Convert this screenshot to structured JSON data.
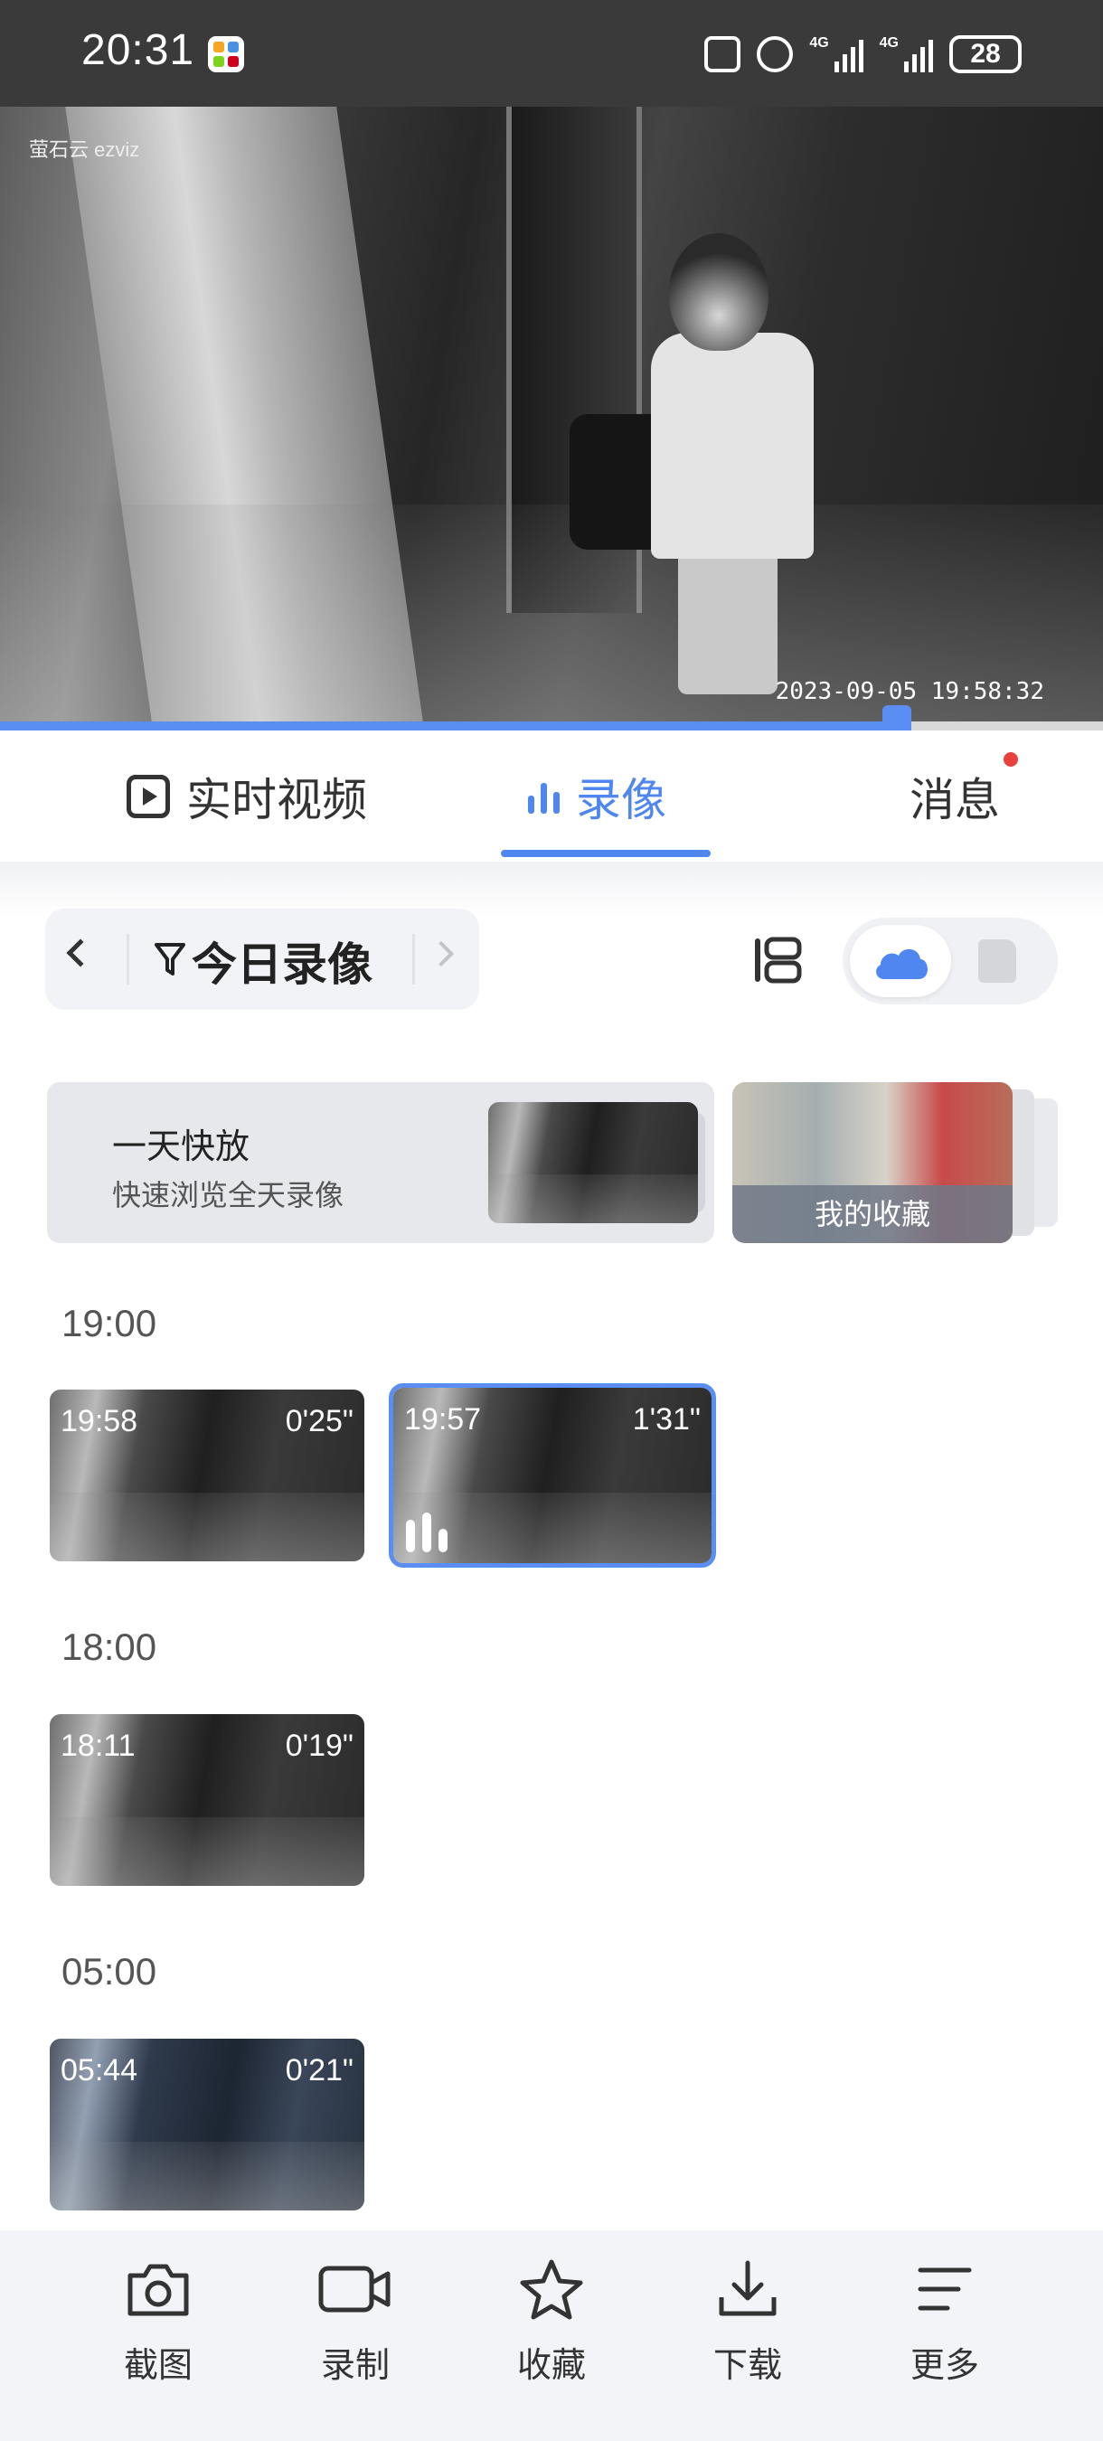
{
  "status_bar": {
    "time": "20:31",
    "network_1": "4G",
    "network_2": "4G",
    "battery": "28"
  },
  "video": {
    "brand_logo": "萤石云 ezviz",
    "timestamp": "2023-09-05 19:58:32",
    "progress": 0.81
  },
  "tabs": [
    {
      "label": "实时视频",
      "icon": "play-square-icon"
    },
    {
      "label": "录像",
      "icon": "bar-chart-icon",
      "active": true
    },
    {
      "label": "消息",
      "icon": "",
      "badge": "red-dot"
    }
  ],
  "filter": {
    "label": "今日录像"
  },
  "storage": {
    "selected": "cloud",
    "options": [
      "cloud",
      "sd-card"
    ]
  },
  "quick_play": {
    "title": "一天快放",
    "subtitle": "快速浏览全天录像"
  },
  "favorites": {
    "label": "我的收藏"
  },
  "timeline": [
    {
      "hour": "19:00",
      "clips": [
        {
          "start": "19:58",
          "duration": "0'25\""
        },
        {
          "start": "19:57",
          "duration": "1'31\"",
          "selected": true
        }
      ]
    },
    {
      "hour": "18:00",
      "clips": [
        {
          "start": "18:11",
          "duration": "0'19\""
        }
      ]
    },
    {
      "hour": "05:00",
      "clips": [
        {
          "start": "05:44",
          "duration": "0'21\""
        }
      ]
    }
  ],
  "toolbar": {
    "screenshot": "截图",
    "record": "录制",
    "favorite": "收藏",
    "download": "下载",
    "more": "更多"
  },
  "colors": {
    "accent": "#4f86f0",
    "badge": "#e8423c",
    "toolbar_bg": "#f3f4f7"
  }
}
